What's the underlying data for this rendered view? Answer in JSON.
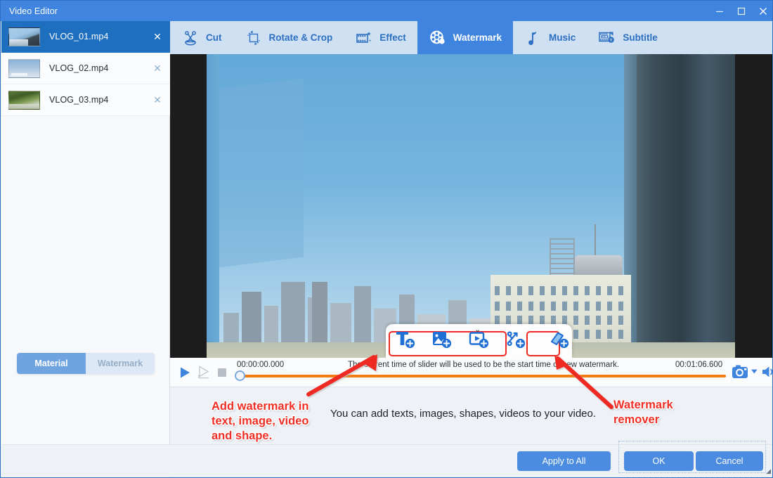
{
  "window": {
    "title": "Video Editor",
    "controls": [
      {
        "name": "minimize",
        "glyph": "—"
      },
      {
        "name": "maximize",
        "glyph": "□"
      },
      {
        "name": "close",
        "glyph": "✕"
      }
    ]
  },
  "sidebar": {
    "media": [
      {
        "name": "VLOG_01.mp4",
        "selected": true,
        "close": "✕"
      },
      {
        "name": "VLOG_02.mp4",
        "selected": false,
        "close": "✕"
      },
      {
        "name": "VLOG_03.mp4",
        "selected": false,
        "close": "✕"
      }
    ],
    "mode_tabs": [
      {
        "label": "Material",
        "active": true
      },
      {
        "label": "Watermark",
        "active": false
      }
    ]
  },
  "toolbar": {
    "tabs": [
      {
        "label": "Cut",
        "icon": "scissors-icon",
        "active": false
      },
      {
        "label": "Rotate & Crop",
        "icon": "crop-icon",
        "active": false
      },
      {
        "label": "Effect",
        "icon": "film-star-icon",
        "active": false
      },
      {
        "label": "Watermark",
        "icon": "reel-drop-icon",
        "active": true
      },
      {
        "label": "Music",
        "icon": "music-note-icon",
        "active": false
      },
      {
        "label": "Subtitle",
        "icon": "subtitle-icon",
        "active": false
      }
    ]
  },
  "watermark_toolbar": {
    "buttons": [
      {
        "name": "add-text-watermark",
        "icon": "text-plus-icon"
      },
      {
        "name": "add-image-watermark",
        "icon": "image-plus-icon"
      },
      {
        "name": "add-video-watermark",
        "icon": "video-plus-icon"
      },
      {
        "name": "add-shape-watermark",
        "icon": "shape-plus-icon"
      },
      {
        "name": "watermark-remover",
        "icon": "eraser-plus-icon"
      }
    ],
    "collapse_caret": "⌄"
  },
  "transport": {
    "play": "▶",
    "play_selection": "▷",
    "stop": "■",
    "current_time": "00:00:00.000",
    "total_time": "00:01:06.600",
    "hint": "The current time of slider will be used to be the start time of new watermark.",
    "snapshot_icon": "camera-icon",
    "snapshot_caret": "▾",
    "volume_icon": "speaker-icon"
  },
  "annotations": {
    "left": "Add watermark in\ntext, image, video\nand shape.",
    "center": "You can add texts, images, shapes, videos to your video.",
    "right": "Watermark\nremover"
  },
  "footer": {
    "apply_to_all": "Apply to All",
    "ok": "OK",
    "cancel": "Cancel"
  },
  "colors": {
    "titlebar": "#3f84df",
    "accent": "#3f84df",
    "tab_active": "#3f84df",
    "toolbar_bg": "#cfe0f3",
    "sidebar_selected": "#1f6fc0",
    "annotation_red": "#ef2f26",
    "slider_track": "#f07c12",
    "button_blue": "#4b8ce0"
  }
}
